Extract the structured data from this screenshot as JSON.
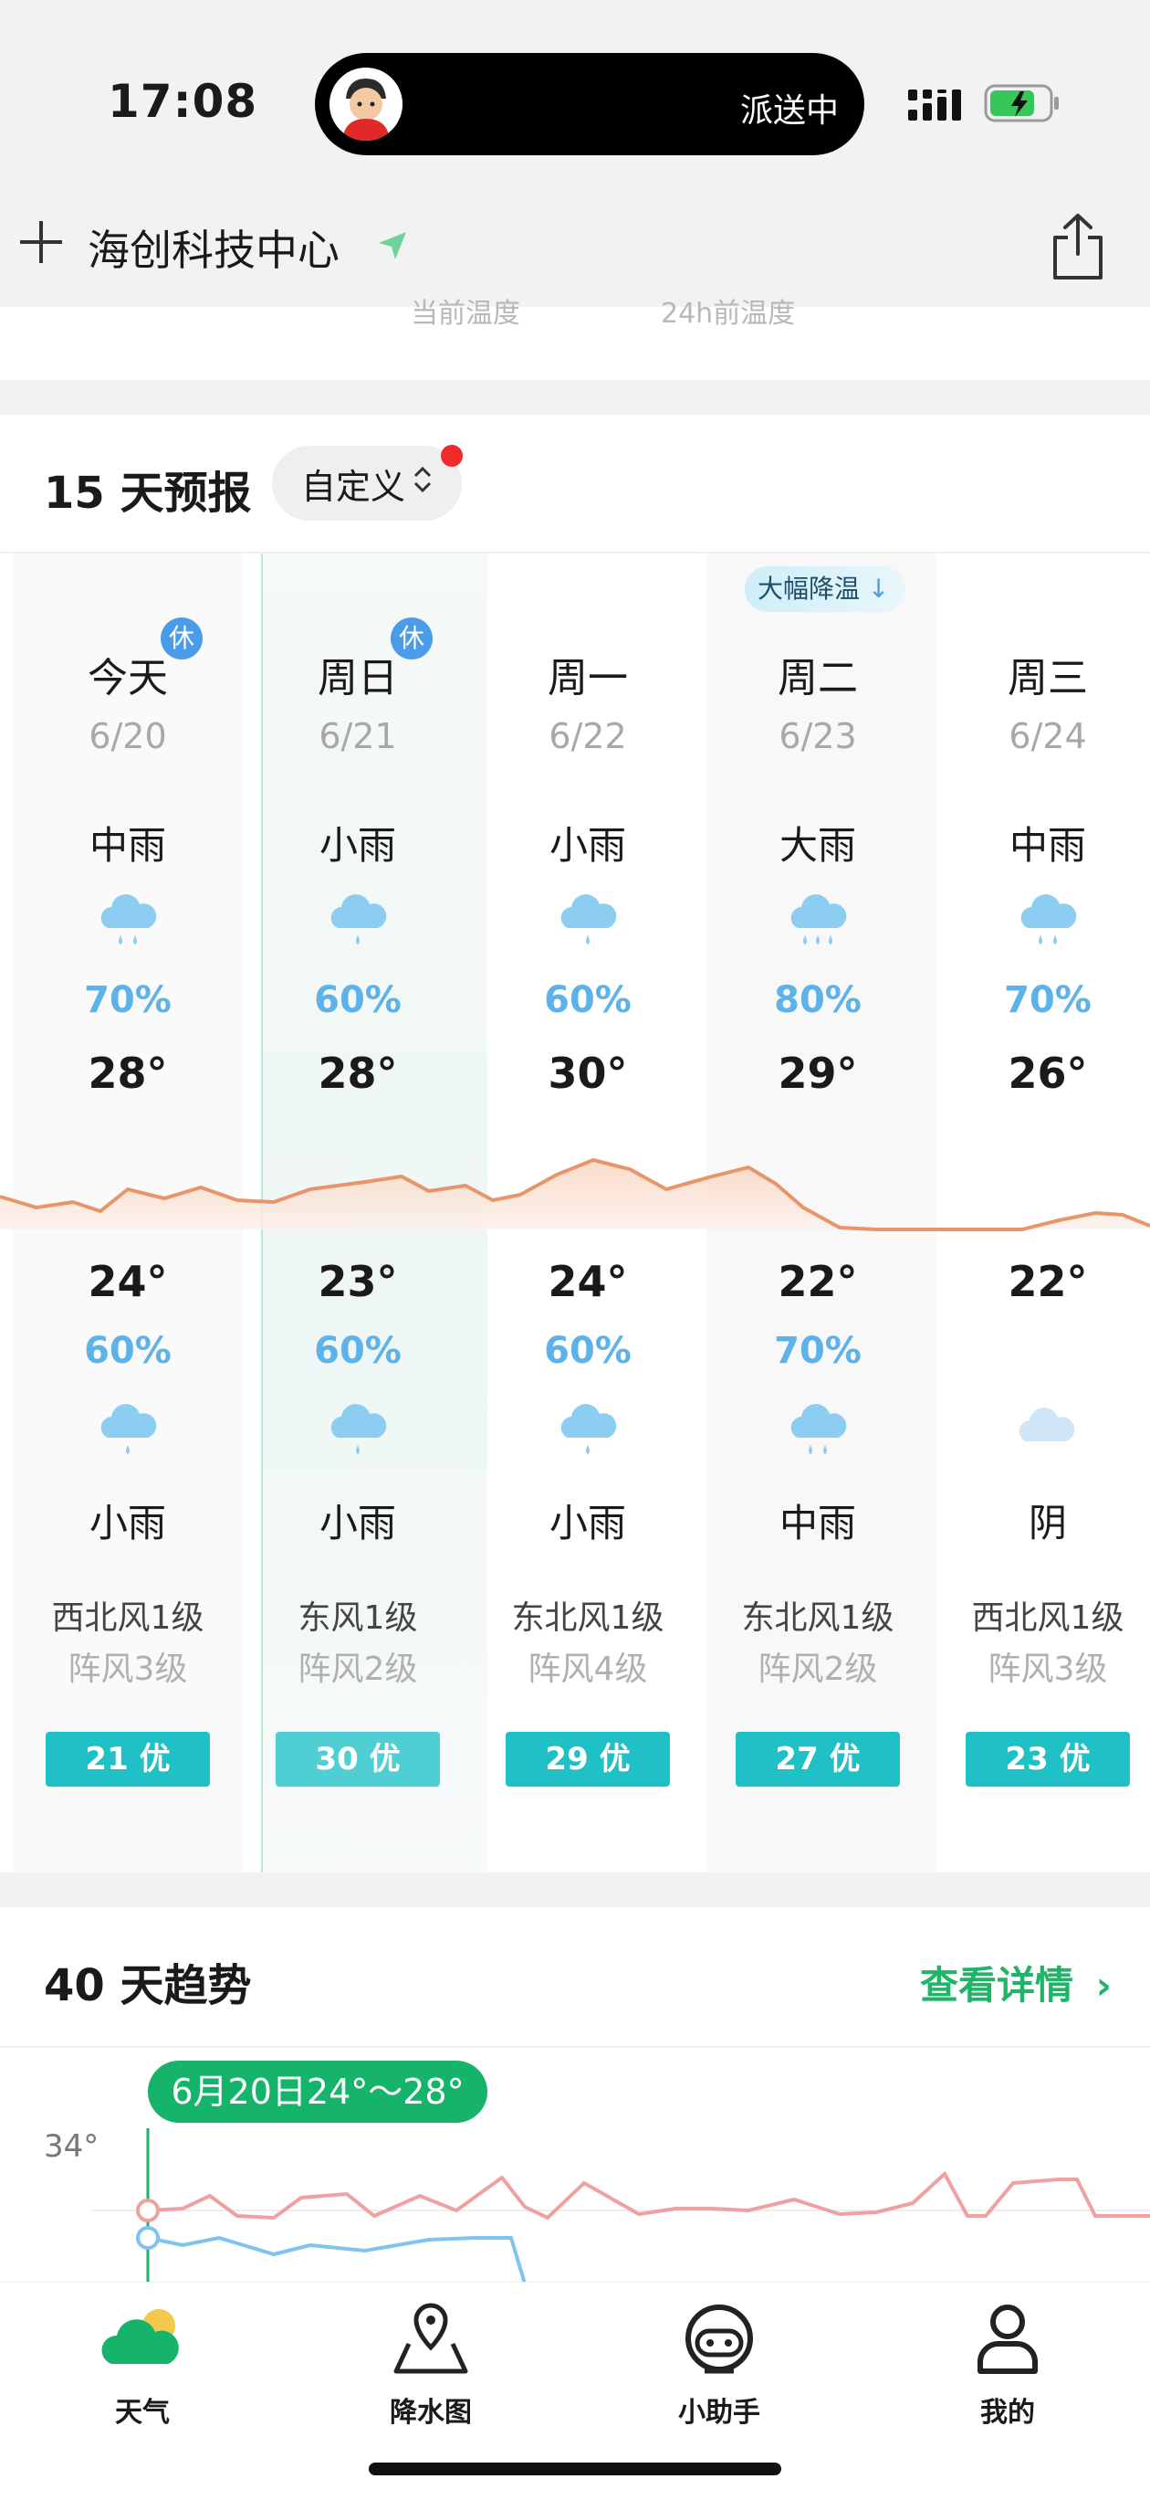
{
  "status_bar": {
    "time": "17:08",
    "island_text": "派送中"
  },
  "header": {
    "location": "海创科技中心"
  },
  "peek": {
    "left": "当前温度",
    "right": "24h前温度"
  },
  "forecast15": {
    "title": "15 天预报",
    "custom_label": "自定义",
    "drop_badge": "大幅降温",
    "days": [
      {
        "day": "今天",
        "date": "6/20",
        "wx_day": "中雨",
        "pct_day": "70%",
        "high": "28°",
        "low": "24°",
        "pct_night": "60%",
        "wx_night": "小雨",
        "wind": "西北风1级",
        "gust": "阵风3级",
        "aqi": "21 优",
        "badge": "休",
        "icon_day": "moderate-rain-icon",
        "icon_night": "light-rain-icon"
      },
      {
        "day": "周日",
        "date": "6/21",
        "wx_day": "小雨",
        "pct_day": "60%",
        "high": "28°",
        "low": "23°",
        "pct_night": "60%",
        "wx_night": "小雨",
        "wind": "东风1级",
        "gust": "阵风2级",
        "aqi": "30 优",
        "badge": "休",
        "icon_day": "light-rain-icon",
        "icon_night": "light-rain-icon"
      },
      {
        "day": "周一",
        "date": "6/22",
        "wx_day": "小雨",
        "pct_day": "60%",
        "high": "30°",
        "low": "24°",
        "pct_night": "60%",
        "wx_night": "小雨",
        "wind": "东北风1级",
        "gust": "阵风4级",
        "aqi": "29 优",
        "badge": "",
        "icon_day": "light-rain-icon",
        "icon_night": "light-rain-icon"
      },
      {
        "day": "周二",
        "date": "6/23",
        "wx_day": "大雨",
        "pct_day": "80%",
        "high": "29°",
        "low": "22°",
        "pct_night": "70%",
        "wx_night": "中雨",
        "wind": "东北风1级",
        "gust": "阵风2级",
        "aqi": "27 优",
        "badge": "",
        "icon_day": "heavy-rain-icon",
        "icon_night": "moderate-rain-icon"
      },
      {
        "day": "周三",
        "date": "6/24",
        "wx_day": "中雨",
        "pct_day": "70%",
        "high": "26°",
        "low": "22°",
        "pct_night": "",
        "wx_night": "阴",
        "wind": "西北风1级",
        "gust": "阵风3级",
        "aqi": "23 优",
        "badge": "",
        "icon_day": "moderate-rain-icon",
        "icon_night": "overcast-cloud-icon"
      }
    ]
  },
  "trend40": {
    "title": "40 天趋势",
    "link": "查看详情",
    "pill": "6月20日24°～28°",
    "y_label": "34°"
  },
  "tabbar": [
    {
      "label": "天气",
      "icon": "weather-icon"
    },
    {
      "label": "降水图",
      "icon": "map-pin-icon"
    },
    {
      "label": "小助手",
      "icon": "assistant-icon"
    },
    {
      "label": "我的",
      "icon": "profile-icon"
    }
  ],
  "colors": {
    "accent_green": "#16b36a",
    "rain_blue": "#5db2ea",
    "aqi_teal": "#1fc0c6",
    "temp_orange": "#e8956a",
    "trend_red": "#f0a0a0",
    "trend_blue": "#80c2f0"
  }
}
